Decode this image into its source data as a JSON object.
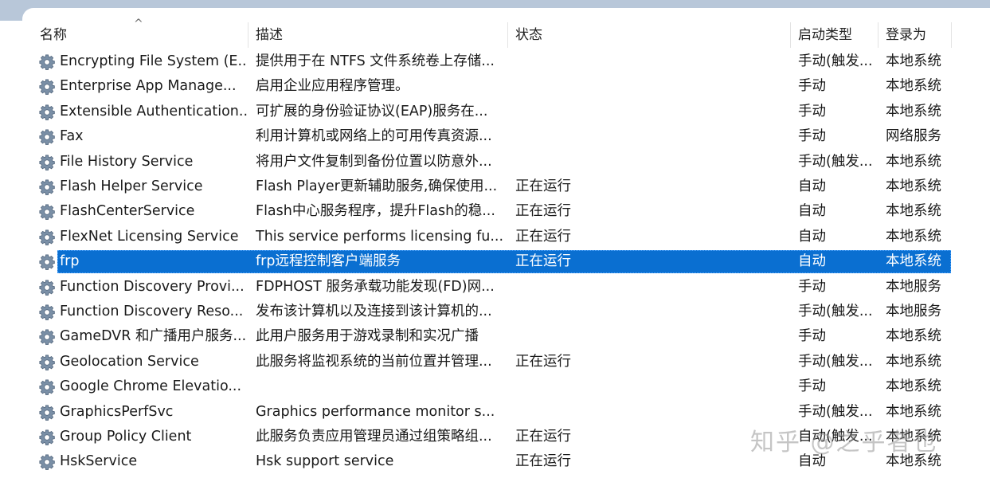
{
  "columns": {
    "name": "名称",
    "description": "描述",
    "status": "状态",
    "startup_type": "启动类型",
    "logon_as": "登录为"
  },
  "sort_indicator": "^",
  "selected_index": 8,
  "services": [
    {
      "name": "Encrypting File System (E...",
      "description": "提供用于在 NTFS 文件系统卷上存储...",
      "status": "",
      "startup_type": "手动(触发...",
      "logon_as": "本地系统"
    },
    {
      "name": "Enterprise App Manage...",
      "description": "启用企业应用程序管理。",
      "status": "",
      "startup_type": "手动",
      "logon_as": "本地系统"
    },
    {
      "name": "Extensible Authentication...",
      "description": "可扩展的身份验证协议(EAP)服务在...",
      "status": "",
      "startup_type": "手动",
      "logon_as": "本地系统"
    },
    {
      "name": "Fax",
      "description": "利用计算机或网络上的可用传真资源...",
      "status": "",
      "startup_type": "手动",
      "logon_as": "网络服务"
    },
    {
      "name": "File History Service",
      "description": "将用户文件复制到备份位置以防意外...",
      "status": "",
      "startup_type": "手动(触发...",
      "logon_as": "本地系统"
    },
    {
      "name": "Flash Helper Service",
      "description": "Flash Player更新辅助服务,确保使用...",
      "status": "正在运行",
      "startup_type": "自动",
      "logon_as": "本地系统"
    },
    {
      "name": "FlashCenterService",
      "description": "Flash中心服务程序，提升Flash的稳...",
      "status": "正在运行",
      "startup_type": "自动",
      "logon_as": "本地系统"
    },
    {
      "name": "FlexNet Licensing Service",
      "description": "This service performs licensing fu...",
      "status": "正在运行",
      "startup_type": "自动",
      "logon_as": "本地系统"
    },
    {
      "name": "frp",
      "description": "frp远程控制客户端服务",
      "status": "正在运行",
      "startup_type": "自动",
      "logon_as": "本地系统"
    },
    {
      "name": "Function Discovery Provi...",
      "description": "FDPHOST 服务承载功能发现(FD)网...",
      "status": "",
      "startup_type": "手动",
      "logon_as": "本地服务"
    },
    {
      "name": "Function Discovery Reso...",
      "description": "发布该计算机以及连接到该计算机的...",
      "status": "",
      "startup_type": "手动(触发...",
      "logon_as": "本地服务"
    },
    {
      "name": "GameDVR 和广播用户服务...",
      "description": "此用户服务用于游戏录制和实况广播",
      "status": "",
      "startup_type": "手动",
      "logon_as": "本地系统"
    },
    {
      "name": "Geolocation Service",
      "description": "此服务将监视系统的当前位置并管理...",
      "status": "正在运行",
      "startup_type": "手动(触发...",
      "logon_as": "本地系统"
    },
    {
      "name": "Google Chrome Elevatio...",
      "description": "",
      "status": "",
      "startup_type": "手动",
      "logon_as": "本地系统"
    },
    {
      "name": "GraphicsPerfSvc",
      "description": "Graphics performance monitor s...",
      "status": "",
      "startup_type": "手动(触发...",
      "logon_as": "本地系统"
    },
    {
      "name": "Group Policy Client",
      "description": "此服务负责应用管理员通过组策略组...",
      "status": "正在运行",
      "startup_type": "自动(触发...",
      "logon_as": "本地系统"
    },
    {
      "name": "HskService",
      "description": "Hsk support service",
      "status": "正在运行",
      "startup_type": "自动",
      "logon_as": "本地系统"
    }
  ],
  "watermark": "知乎 @之乎者也",
  "colors": {
    "selection": "#0a6fd1",
    "topbar": "#b8c7d9"
  },
  "row_icon": "gear-icon"
}
